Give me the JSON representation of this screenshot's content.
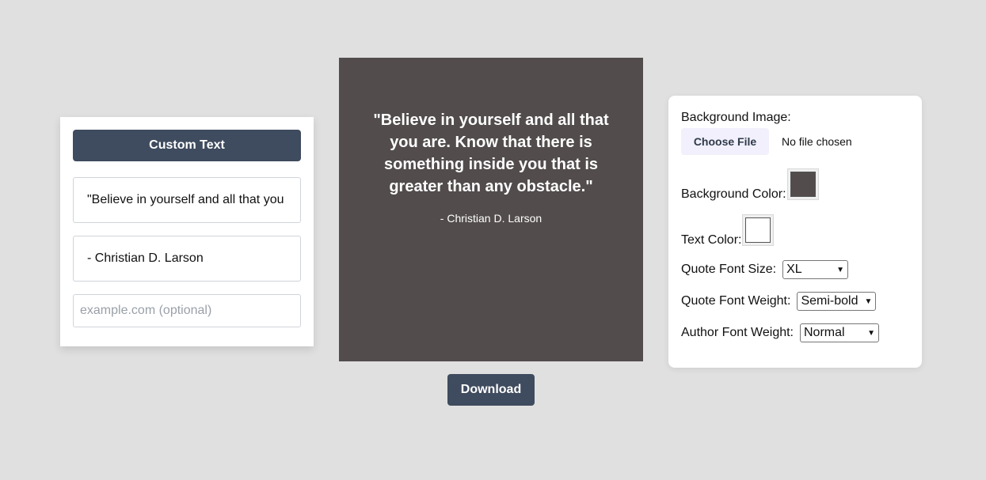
{
  "editor": {
    "custom_text_label": "Custom Text",
    "quote_value": "\"Believe in yourself and all that you are. Know that there is something inside you that is greater than any obstacle.\"",
    "author_value": "- Christian D. Larson",
    "website_placeholder": "example.com (optional)"
  },
  "preview": {
    "quote": "\"Believe in yourself and all that you are. Know that there is something inside you that is greater than any obstacle.\"",
    "author": "- Christian D. Larson",
    "background_color": "#524c4c",
    "text_color": "#ffffff"
  },
  "download_label": "Download",
  "settings": {
    "background_image_label": "Background Image:",
    "choose_file_label": "Choose File",
    "no_file_text": "No file chosen",
    "background_color_label": "Background Color:",
    "background_color_value": "#524c4c",
    "text_color_label": "Text Color:",
    "text_color_value": "#ffffff",
    "quote_font_size_label": "Quote Font Size:",
    "quote_font_size_value": "XL",
    "quote_font_weight_label": "Quote Font Weight:",
    "quote_font_weight_value": "Semi-bold",
    "author_font_weight_label": "Author Font Weight:",
    "author_font_weight_value": "Normal"
  },
  "icons": {
    "select_chevron": "chevron-down-icon"
  },
  "colors": {
    "accent": "#3f4b5e",
    "page_background": "#e0e0e0"
  }
}
